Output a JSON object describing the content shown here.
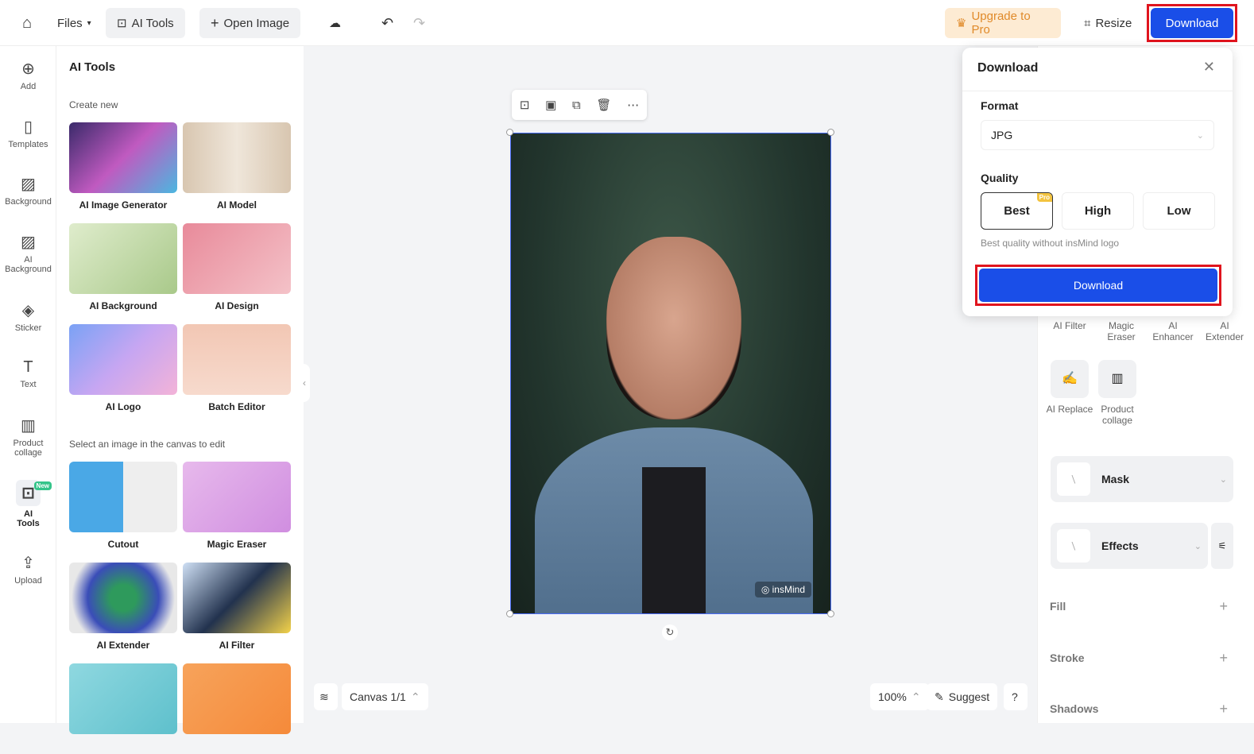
{
  "topbar": {
    "files": "Files",
    "ai_tools": "AI Tools",
    "open_image": "Open Image",
    "upgrade": "Upgrade to Pro",
    "resize": "Resize",
    "download": "Download"
  },
  "rail": [
    {
      "label": "Add",
      "icon": "plus-circle-icon"
    },
    {
      "label": "Templates",
      "icon": "templates-icon"
    },
    {
      "label": "Background",
      "icon": "background-icon"
    },
    {
      "label": "AI Background",
      "icon": "ai-background-icon"
    },
    {
      "label": "Sticker",
      "icon": "sticker-icon"
    },
    {
      "label": "Text",
      "icon": "text-icon"
    },
    {
      "label": "Product collage",
      "icon": "collage-icon"
    },
    {
      "label": "AI Tools",
      "icon": "ai-tools-icon",
      "badge": "New"
    },
    {
      "label": "Upload",
      "icon": "upload-icon"
    }
  ],
  "panel": {
    "title": "AI Tools",
    "create_new": "Create new",
    "select_hint": "Select an image in the canvas to edit",
    "create_tools": [
      "AI Image Generator",
      "AI Model",
      "AI Background",
      "AI Design",
      "AI Logo",
      "Batch Editor"
    ],
    "edit_tools": [
      "Cutout",
      "Magic Eraser",
      "AI Extender",
      "AI Filter"
    ]
  },
  "canvas": {
    "watermark": "insMind",
    "canvas_label": "Canvas 1/1",
    "zoom": "100%",
    "suggest": "Suggest",
    "help": "?"
  },
  "download_panel": {
    "title": "Download",
    "format_label": "Format",
    "format_value": "JPG",
    "quality_label": "Quality",
    "qualities": [
      "Best",
      "High",
      "Low"
    ],
    "selected_quality": "Best",
    "pro_badge": "Pro",
    "hint": "Best quality without insMind logo",
    "button": "Download"
  },
  "right": {
    "tools_row1": [
      "AI Filter",
      "Magic Eraser",
      "AI Enhancer",
      "AI Extender"
    ],
    "tools_row2": [
      "AI Replace",
      "Product collage"
    ],
    "mask": "Mask",
    "effects": "Effects",
    "sections": [
      "Fill",
      "Stroke",
      "Shadows"
    ]
  },
  "colors": {
    "accent": "#1a4ee8",
    "highlight": "#e0141e",
    "upgrade_bg": "#fdebd3"
  }
}
